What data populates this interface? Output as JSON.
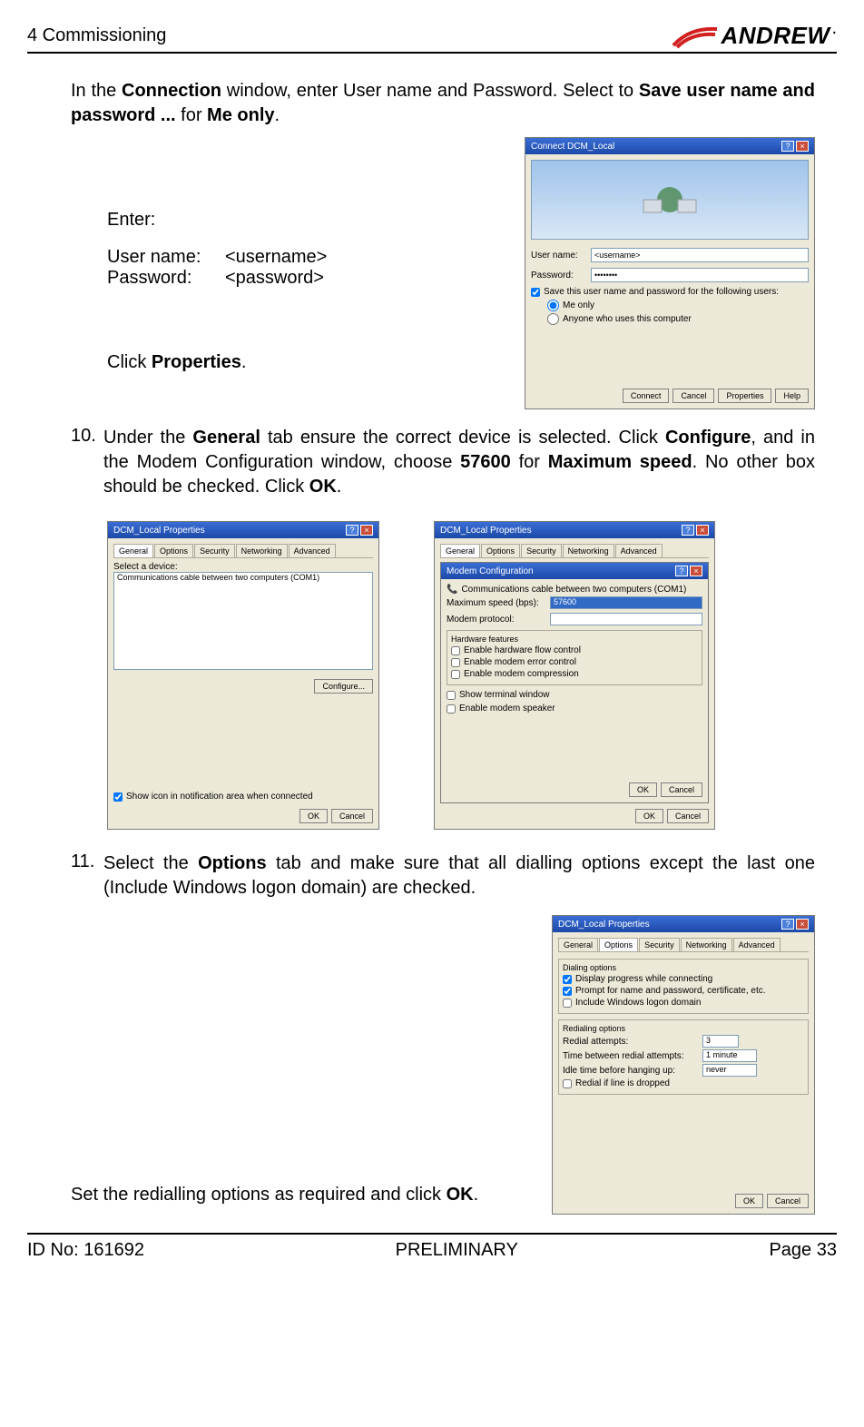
{
  "header": {
    "chapter": "4 Commissioning",
    "logo_text": "ANDREW",
    "logo_mark": "red-swoosh-icon",
    "logo_sub": "."
  },
  "para1": {
    "prefix": "In the ",
    "b1": "Connection",
    "mid1": " window, enter User name and Password. Select to ",
    "b2": "Save user name and password ...",
    "mid2": " for ",
    "b3": "Me only",
    "suffix": "."
  },
  "creds": {
    "enter": "Enter:",
    "user_label": "User name:",
    "user_value": "<username>",
    "pass_label": "Password:",
    "pass_value": "<password>",
    "click_prefix": "Click ",
    "click_bold": "Properties",
    "click_suffix": "."
  },
  "dialog_connect": {
    "title": "Connect DCM_Local",
    "user_label": "User name:",
    "user_value": "<username>",
    "pass_label": "Password:",
    "pass_value": "••••••••",
    "save_cb": "Save this user name and password for the following users:",
    "radio_me": "Me only",
    "radio_anyone": "Anyone who uses this computer",
    "btn_connect": "Connect",
    "btn_cancel": "Cancel",
    "btn_properties": "Properties",
    "btn_help": "Help"
  },
  "step10": {
    "num": "10.",
    "t1": "Under the ",
    "b1": "General",
    "t2": " tab ensure the correct device is selected. Click ",
    "b2": "Configure",
    "t3": ", and in the Modem Configuration window, choose ",
    "b3": "57600",
    "t4": " for ",
    "b4": "Maximum speed",
    "t5": ". No other box should be checked. Click ",
    "b5": "OK",
    "t6": "."
  },
  "dialog_props": {
    "title": "DCM_Local Properties",
    "tabs": [
      "General",
      "Options",
      "Security",
      "Networking",
      "Advanced"
    ],
    "select_label": "Select a device:",
    "device": "Communications cable between two computers (COM1)",
    "btn_configure": "Configure...",
    "show_icon": "Show icon in notification area when connected",
    "btn_ok": "OK",
    "btn_cancel": "Cancel"
  },
  "dialog_modem": {
    "title": "DCM_Local Properties",
    "tabs": [
      "General",
      "Options",
      "Security",
      "Networking",
      "Advanced"
    ],
    "inner_title": "Modem Configuration",
    "device": "Communications cable between two computers (COM1)",
    "max_speed_label": "Maximum speed (bps):",
    "max_speed_value": "57600",
    "protocol_label": "Modem protocol:",
    "hw_group": "Hardware features",
    "cb_hw_flow": "Enable hardware flow control",
    "cb_modem_err": "Enable modem error control",
    "cb_modem_comp": "Enable modem compression",
    "cb_show_term": "Show terminal window",
    "cb_speaker": "Enable modem speaker",
    "btn_ok": "OK",
    "btn_cancel": "Cancel"
  },
  "step11": {
    "num": "11.",
    "t1": "Select the ",
    "b1": "Options",
    "t2": " tab and make sure that all dialling options except the last one (Include Windows logon domain) are checked."
  },
  "options_footer": {
    "t1": "Set the redialling options as required and click ",
    "b1": "OK",
    "t2": "."
  },
  "dialog_options": {
    "title": "DCM_Local Properties",
    "tabs": [
      "General",
      "Options",
      "Security",
      "Networking",
      "Advanced"
    ],
    "grp_dial": "Dialing options",
    "cb_display": "Display progress while connecting",
    "cb_prompt": "Prompt for name and password, certificate, etc.",
    "cb_logon": "Include Windows logon domain",
    "grp_redial": "Redialing options",
    "redial_attempts": "Redial attempts:",
    "redial_attempts_v": "3",
    "time_between": "Time between redial attempts:",
    "time_between_v": "1 minute",
    "idle_time": "Idle time before hanging up:",
    "idle_time_v": "never",
    "cb_redial_drop": "Redial if line is dropped",
    "btn_ok": "OK",
    "btn_cancel": "Cancel"
  },
  "footer": {
    "id": "ID No: 161692",
    "status": "PRELIMINARY",
    "page": "Page 33"
  }
}
